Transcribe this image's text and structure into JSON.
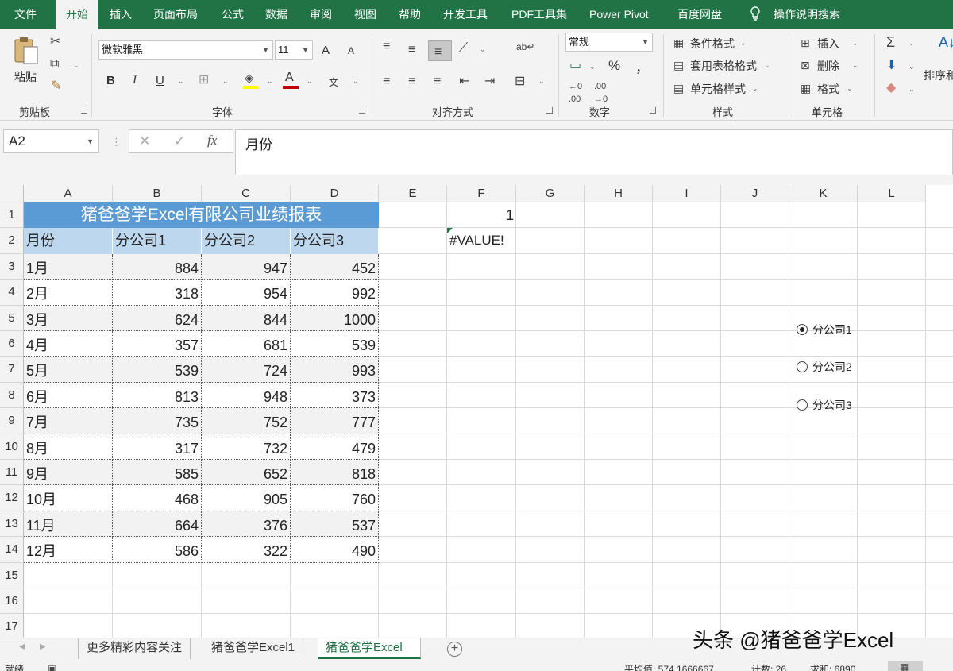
{
  "colors": {
    "excel_green": "#217346",
    "title_fill": "#5b9bd5",
    "header_fill": "#bdd7ee",
    "stripe_fill": "#f2f2f2",
    "error_marker": "#217346"
  },
  "tabs": [
    "文件",
    "开始",
    "插入",
    "页面布局",
    "公式",
    "数据",
    "审阅",
    "视图",
    "帮助",
    "开发工具",
    "PDF工具集",
    "Power Pivot",
    "百度网盘",
    "操作说明搜索"
  ],
  "ribbon": {
    "clipboard": {
      "paste": "粘贴",
      "label": "剪贴板"
    },
    "font": {
      "name": "微软雅黑",
      "size": "11",
      "bold": "B",
      "italic": "I",
      "underline": "U",
      "grow": "A",
      "shrink": "A",
      "font_color": "A",
      "phonetic": "文",
      "label": "字体"
    },
    "alignment": {
      "label": "对齐方式"
    },
    "number": {
      "format": "常规",
      "percent": "%",
      "comma": "，",
      "label": "数字"
    },
    "styles": {
      "conditional": "条件格式",
      "table": "套用表格格式",
      "cell": "单元格样式",
      "label": "样式"
    },
    "cells": {
      "insert": "插入",
      "delete": "删除",
      "format": "格式",
      "label": "单元格"
    },
    "editing": {
      "sort": "排序和"
    }
  },
  "formula_bar": {
    "name_box": "A2",
    "cancel": "✕",
    "enter": "✓",
    "fx": "fx",
    "content": "月份"
  },
  "columns": [
    "A",
    "B",
    "C",
    "D",
    "E",
    "F",
    "G",
    "H",
    "I",
    "J",
    "K",
    "L"
  ],
  "rows": [
    "1",
    "2",
    "3",
    "4",
    "5",
    "6",
    "7",
    "8",
    "9",
    "10",
    "11",
    "12",
    "13",
    "14",
    "15",
    "16",
    "17"
  ],
  "table": {
    "title": "猪爸爸学Excel有限公司业绩报表",
    "headers": [
      "月份",
      "分公司1",
      "分公司2",
      "分公司3"
    ],
    "rows": [
      [
        "1月",
        "884",
        "947",
        "452"
      ],
      [
        "2月",
        "318",
        "954",
        "992"
      ],
      [
        "3月",
        "624",
        "844",
        "1000"
      ],
      [
        "4月",
        "357",
        "681",
        "539"
      ],
      [
        "5月",
        "539",
        "724",
        "993"
      ],
      [
        "6月",
        "813",
        "948",
        "373"
      ],
      [
        "7月",
        "735",
        "752",
        "777"
      ],
      [
        "8月",
        "317",
        "732",
        "479"
      ],
      [
        "9月",
        "585",
        "652",
        "818"
      ],
      [
        "10月",
        "468",
        "905",
        "760"
      ],
      [
        "11月",
        "664",
        "376",
        "537"
      ],
      [
        "12月",
        "586",
        "322",
        "490"
      ]
    ]
  },
  "f1": "1",
  "f2": "#VALUE!",
  "radios": [
    {
      "label": "分公司1",
      "selected": true
    },
    {
      "label": "分公司2",
      "selected": false
    },
    {
      "label": "分公司3",
      "selected": false
    }
  ],
  "sheets": [
    "更多精彩内容关注",
    "猪爸爸学Excel1",
    "猪爸爸学Excel"
  ],
  "add_sheet": "+",
  "status": {
    "ready": "就绪",
    "average": "平均值: 574.1666667",
    "count": "计数: 26",
    "sum": "求和: 6890"
  },
  "watermark": "头条 @猪爸爸学Excel"
}
